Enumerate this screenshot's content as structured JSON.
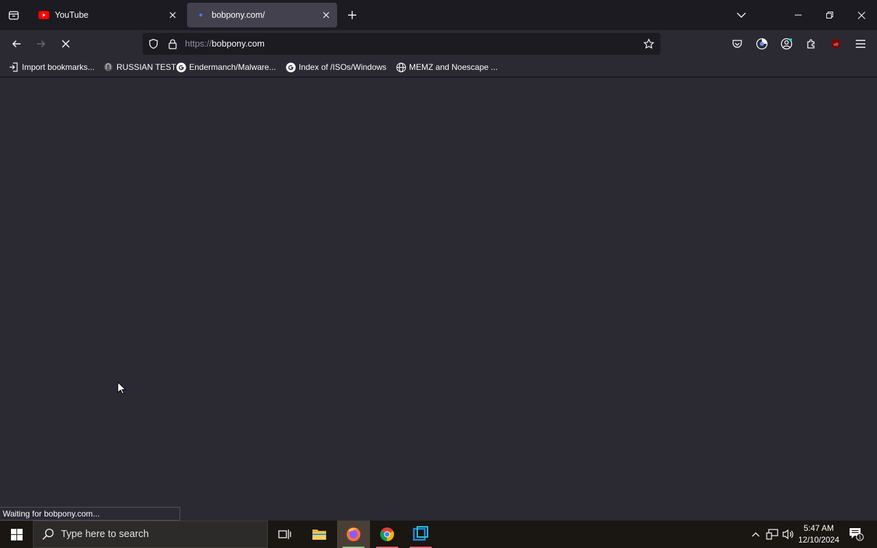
{
  "tabs": [
    {
      "title": "YouTube",
      "active": false
    },
    {
      "title": "bobpony.com/",
      "active": true
    }
  ],
  "url": {
    "scheme": "https://",
    "host": "bobpony.com"
  },
  "bookmarks": [
    {
      "label": "Import bookmarks...",
      "icon": "import-icon"
    },
    {
      "label": "RUSSIAN TEST",
      "icon": "favicon-icon"
    },
    {
      "label": "Endermanch/Malware...",
      "icon": "google-icon"
    },
    {
      "label": "Index of /ISOs/Windows",
      "icon": "google-icon"
    },
    {
      "label": "MEMZ and Noescape ...",
      "icon": "globe-icon"
    }
  ],
  "status_text": "Waiting for bobpony.com...",
  "taskbar": {
    "search_placeholder": "Type here to search",
    "time": "5:47 AM",
    "date": "12/10/2024",
    "notification_count": "1"
  },
  "colors": {
    "accent": "#00ddff",
    "page_bg": "#2b2a33",
    "tabstrip_bg": "#1c1b22",
    "youtube_red": "#ff0000",
    "loading_blue": "#4a7cff"
  }
}
